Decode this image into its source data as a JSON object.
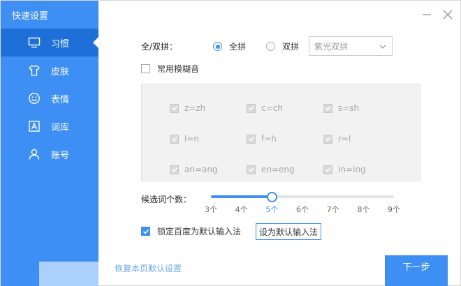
{
  "sidebar": {
    "title": "快速设置",
    "items": [
      {
        "label": "习惯",
        "icon": "monitor-icon",
        "active": true
      },
      {
        "label": "皮肤",
        "icon": "tshirt-icon",
        "active": false
      },
      {
        "label": "表情",
        "icon": "smiley-icon",
        "active": false
      },
      {
        "label": "词库",
        "icon": "dictionary-icon",
        "active": false
      },
      {
        "label": "账号",
        "icon": "user-icon",
        "active": false
      }
    ]
  },
  "pinyin": {
    "label": "全/双拼：",
    "options": [
      "全拼",
      "双拼"
    ],
    "selected": "全拼",
    "scheme_value": "紫光双拼"
  },
  "fuzzy": {
    "toggle_label": "常用模糊音",
    "enabled": false,
    "items": [
      "z=zh",
      "c=ch",
      "s=sh",
      "l=n",
      "f=h",
      "r=l",
      "an=ang",
      "en=eng",
      "in=ing"
    ]
  },
  "candidates": {
    "label": "候选词个数：",
    "ticks": [
      "3个",
      "4个",
      "5个",
      "6个",
      "7个",
      "8个",
      "9个"
    ],
    "selected_index": 2
  },
  "lock_default": {
    "label": "锁定百度为默认输入法",
    "checked": true,
    "button_label": "设为默认输入法"
  },
  "footer": {
    "restore_label": "恢复本页默认设置",
    "next_label": "下一步"
  },
  "colors": {
    "accent": "#3d8ff3",
    "sidebar_active": "#1f6fd8"
  }
}
